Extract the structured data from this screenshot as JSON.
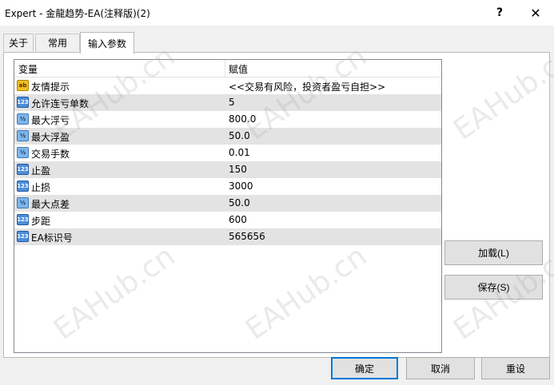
{
  "window": {
    "title": "Expert - 金龍趋势-EA(注释版)(2)",
    "help_glyph": "?",
    "close_glyph": "✕"
  },
  "tabs": [
    {
      "label": "关于"
    },
    {
      "label": "常用"
    },
    {
      "label": "输入参数"
    }
  ],
  "grid": {
    "headers": {
      "variable": "变量",
      "value": "赋值"
    },
    "rows": [
      {
        "icon": "string-type-icon",
        "icon_text": "ab",
        "name": "友情提示",
        "value": "<<交易有风险，投资者盈亏自担>>"
      },
      {
        "icon": "integer-type-icon",
        "icon_text": "123",
        "name": "允许连亏单数",
        "value": "5"
      },
      {
        "icon": "double-type-icon",
        "icon_text": "½",
        "name": "最大浮亏",
        "value": "800.0"
      },
      {
        "icon": "double-type-icon",
        "icon_text": "½",
        "name": "最大浮盈",
        "value": "50.0"
      },
      {
        "icon": "double-type-icon",
        "icon_text": "½",
        "name": "交易手数",
        "value": "0.01"
      },
      {
        "icon": "integer-type-icon",
        "icon_text": "123",
        "name": "止盈",
        "value": "150"
      },
      {
        "icon": "integer-type-icon",
        "icon_text": "123",
        "name": "止损",
        "value": "3000"
      },
      {
        "icon": "double-type-icon",
        "icon_text": "½",
        "name": "最大点差",
        "value": "50.0"
      },
      {
        "icon": "integer-type-icon",
        "icon_text": "123",
        "name": "步距",
        "value": "600"
      },
      {
        "icon": "integer-type-icon",
        "icon_text": "123",
        "name": "EA标识号",
        "value": "565656"
      }
    ]
  },
  "buttons": {
    "load": "加载(L)",
    "save": "保存(S)",
    "ok": "确定",
    "cancel": "取消",
    "reset": "重设"
  },
  "watermark": "EAHub.cn"
}
